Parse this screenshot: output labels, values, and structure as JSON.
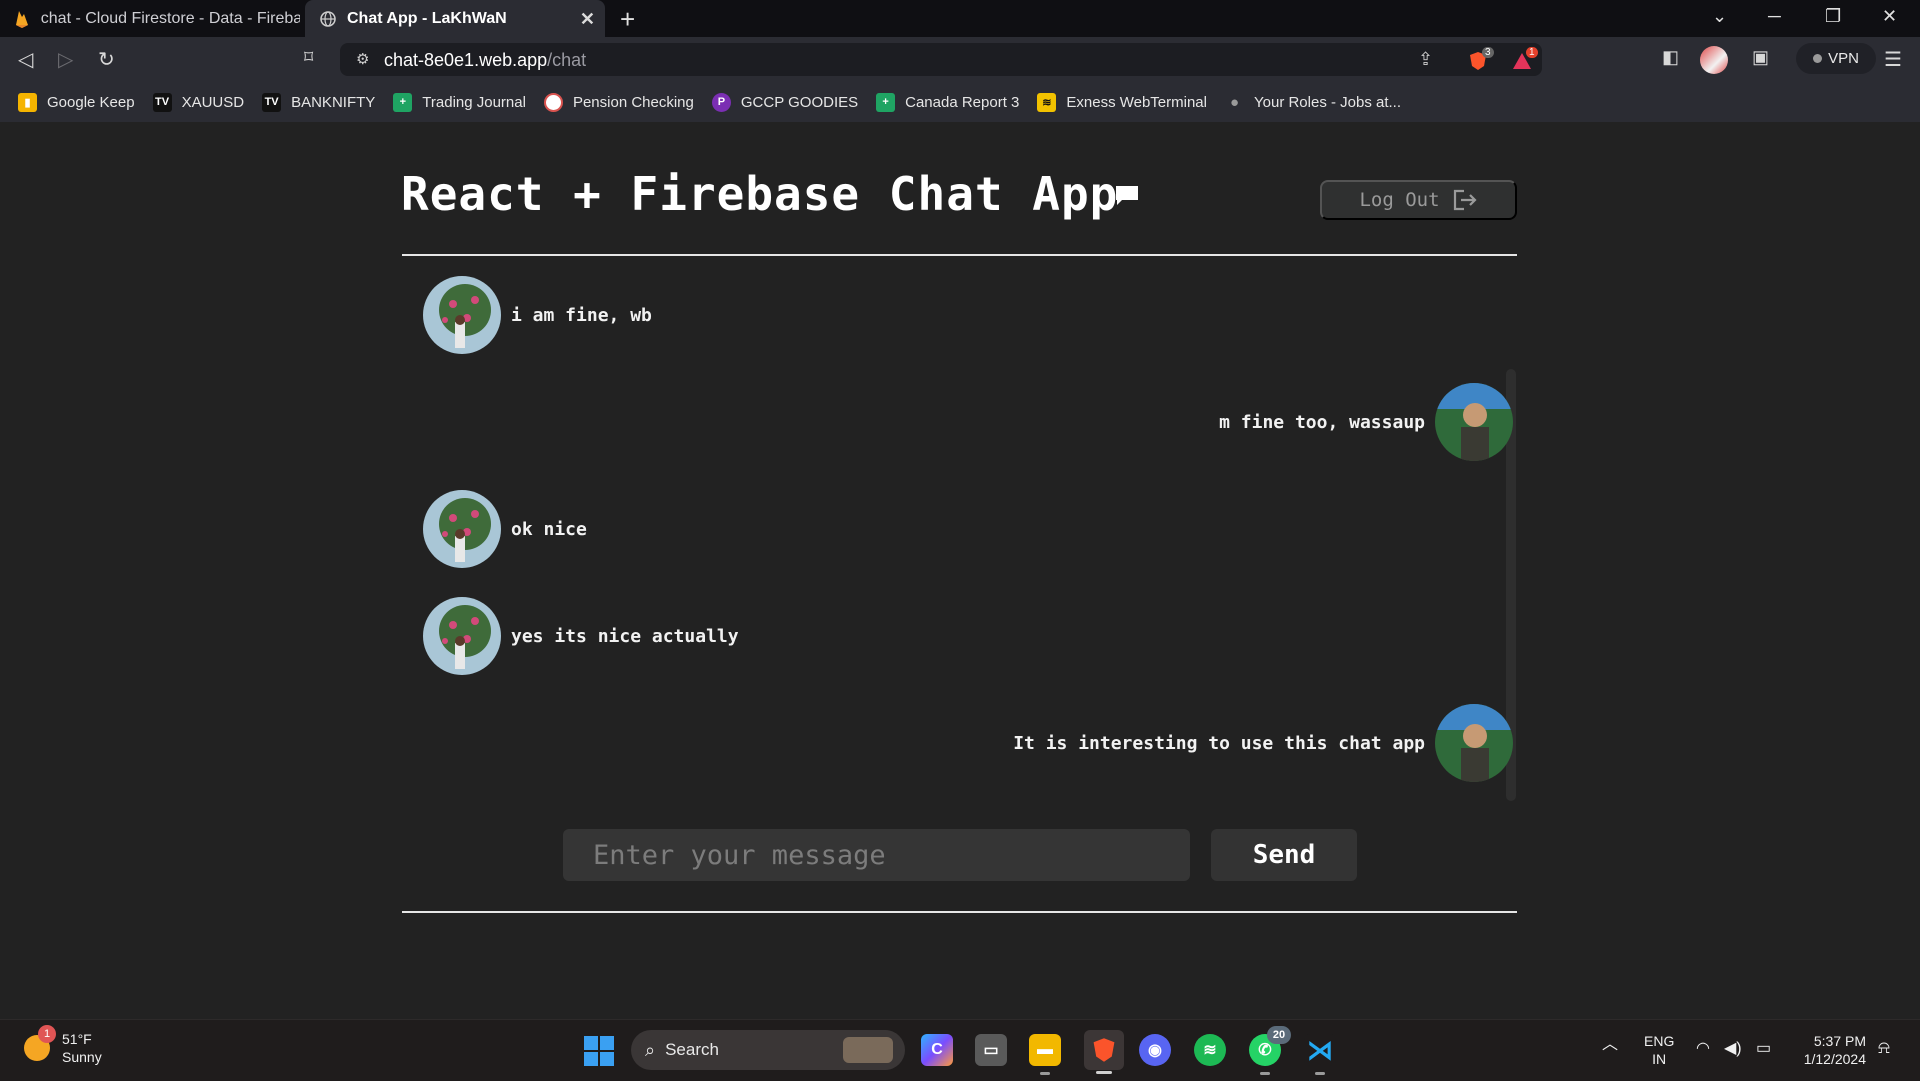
{
  "browser": {
    "tabs": [
      {
        "title": "chat - Cloud Firestore - Data - Firebase",
        "active": false
      },
      {
        "title": "Chat App - LaKhWaN",
        "active": true
      }
    ],
    "url_domain": "chat-8e0e1.web.app",
    "url_path": "/chat",
    "shield_count": "3",
    "alert_count": "1",
    "vpn_label": "VPN",
    "bookmarks": [
      {
        "label": "Google Keep",
        "icon": "google-keep-icon",
        "color": "#f5b400"
      },
      {
        "label": "XAUUSD",
        "icon": "tradingview-icon",
        "color": "#111111"
      },
      {
        "label": "BANKNIFTY",
        "icon": "tradingview-icon",
        "color": "#111111"
      },
      {
        "label": "Trading Journal",
        "icon": "sheets-icon",
        "color": "#1fa463"
      },
      {
        "label": "Pension Checking",
        "icon": "pension-icon",
        "color": "#d9534f"
      },
      {
        "label": "GCCP GOODIES",
        "icon": "p-icon",
        "color": "#7b2fb3"
      },
      {
        "label": "Canada Report 3",
        "icon": "sheets-icon",
        "color": "#1fa463"
      },
      {
        "label": "Exness WebTerminal",
        "icon": "exness-icon",
        "color": "#f2c200"
      },
      {
        "label": "Your Roles - Jobs at...",
        "icon": "apple-icon",
        "color": "#555555"
      }
    ]
  },
  "app": {
    "title": "React + Firebase Chat App",
    "logout_label": "Log Out",
    "messages": [
      {
        "text": "i am fine, wb",
        "side": "left"
      },
      {
        "text": "m fine too, wassaup",
        "side": "right"
      },
      {
        "text": "ok nice",
        "side": "left"
      },
      {
        "text": "yes its nice actually",
        "side": "left"
      },
      {
        "text": "It is interesting to use this chat app",
        "side": "right"
      }
    ],
    "input_placeholder": "Enter your message",
    "send_label": "Send"
  },
  "taskbar": {
    "weather_temp": "51°F",
    "weather_cond": "Sunny",
    "weather_badge": "1",
    "search_label": "Search",
    "whatsapp_badge": "20",
    "lang": "ENG",
    "region": "IN",
    "time": "5:37 PM",
    "date": "1/12/2024"
  }
}
